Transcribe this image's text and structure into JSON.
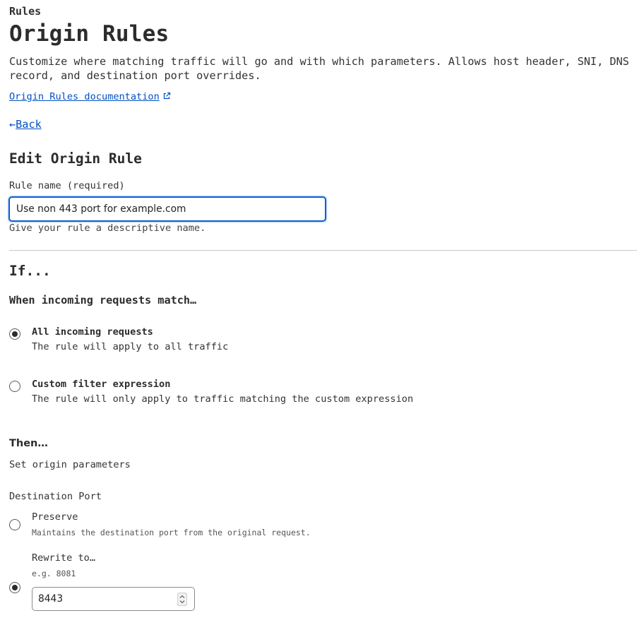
{
  "header": {
    "breadcrumb": "Rules",
    "title": "Origin Rules",
    "description": "Customize where matching traffic will go and with which parameters. Allows host header, SNI, DNS record, and destination port overrides.",
    "doc_link": "Origin Rules documentation",
    "doc_link_icon": "external-link-icon",
    "back_arrow": "←",
    "back_label": "Back"
  },
  "form": {
    "title": "Edit Origin Rule",
    "rule_name_label": "Rule name (required)",
    "rule_name_value": "Use non 443 port for example.com",
    "rule_name_help": "Give your rule a descriptive name."
  },
  "if_section": {
    "heading": "If...",
    "match_heading": "When incoming requests match…",
    "options": [
      {
        "title": "All incoming requests",
        "description": "The rule will apply to all traffic",
        "selected": true
      },
      {
        "title": "Custom filter expression",
        "description": "The rule will only apply to traffic matching the custom expression",
        "selected": false
      }
    ]
  },
  "then_section": {
    "heading": "Then…",
    "subheading": "Set origin parameters",
    "destination_port": {
      "label": "Destination Port",
      "options": [
        {
          "title": "Preserve",
          "description": "Maintains the destination port from the original request.",
          "selected": false
        },
        {
          "title": "Rewrite to…",
          "description": "e.g. 8081",
          "selected": true
        }
      ],
      "value": "8443",
      "stepper_icon": "stepper-updown-icon"
    }
  },
  "colors": {
    "accent": "#0051c3",
    "focus_border": "#0a5fd7",
    "text": "#313131",
    "divider": "#c9c9c9"
  }
}
